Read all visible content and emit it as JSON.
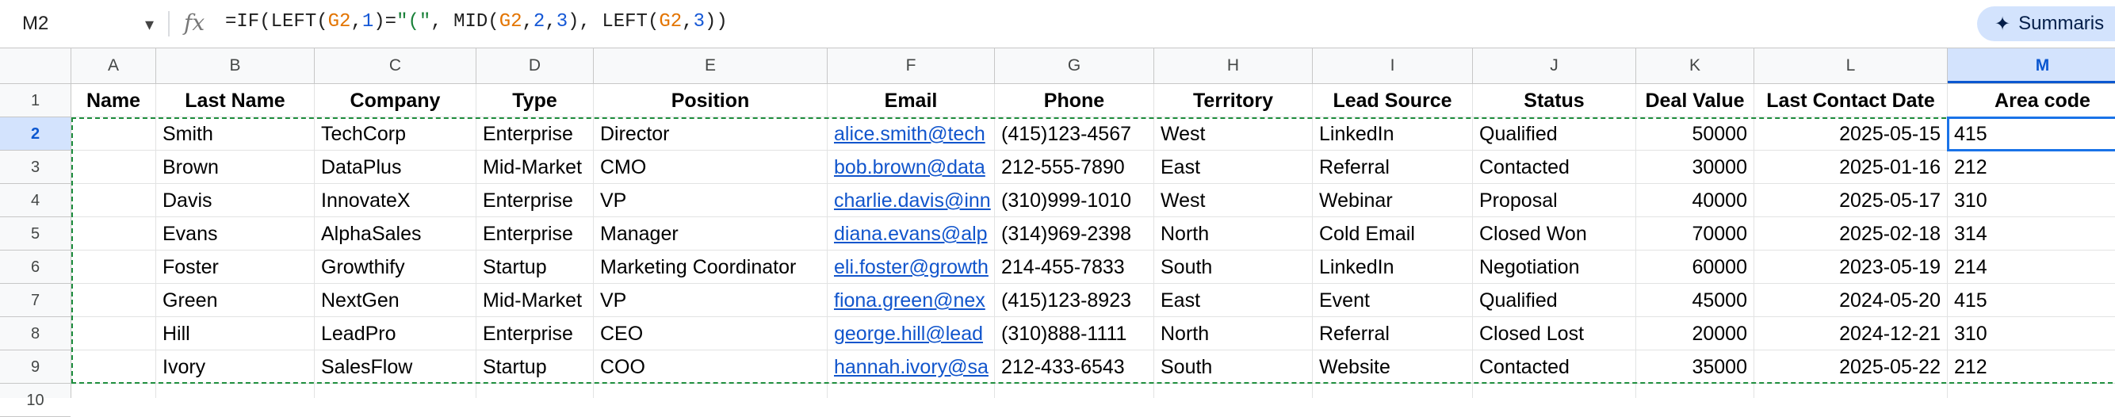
{
  "formula_bar": {
    "name_box": "M2",
    "fx_label": "fx",
    "formula_tokens": [
      {
        "t": "=IF(LEFT(",
        "k": "txt"
      },
      {
        "t": "G2",
        "k": "ref"
      },
      {
        "t": ",",
        "k": "txt"
      },
      {
        "t": "1",
        "k": "num"
      },
      {
        "t": ")=",
        "k": "txt"
      },
      {
        "t": "\"(\"",
        "k": "str"
      },
      {
        "t": ", MID(",
        "k": "txt"
      },
      {
        "t": "G2",
        "k": "ref"
      },
      {
        "t": ",",
        "k": "txt"
      },
      {
        "t": "2",
        "k": "num"
      },
      {
        "t": ",",
        "k": "txt"
      },
      {
        "t": "3",
        "k": "num"
      },
      {
        "t": "), LEFT(",
        "k": "txt"
      },
      {
        "t": "G2",
        "k": "ref"
      },
      {
        "t": ",",
        "k": "txt"
      },
      {
        "t": "3",
        "k": "num"
      },
      {
        "t": "))",
        "k": "txt"
      }
    ],
    "summarize_label": "Summaris"
  },
  "columns": [
    "A",
    "B",
    "C",
    "D",
    "E",
    "F",
    "G",
    "H",
    "I",
    "J",
    "K",
    "L",
    "M"
  ],
  "selected_column": "M",
  "row_numbers": [
    "1",
    "2",
    "3",
    "4",
    "5",
    "6",
    "7",
    "8",
    "9",
    "10"
  ],
  "selected_row": "2",
  "header_row": [
    "Name",
    "Last Name",
    "Company",
    "Type",
    "Position",
    "Email",
    "Phone",
    "Territory",
    "Lead Source",
    "Status",
    "Deal Value",
    "Last Contact Date",
    "Area code"
  ],
  "rows": [
    [
      "",
      "Smith",
      "TechCorp",
      "Enterprise",
      "Director",
      "alice.smith@tech",
      "(415)123-4567",
      "West",
      "LinkedIn",
      "Qualified",
      "50000",
      "2025-05-15",
      "415"
    ],
    [
      "",
      "Brown",
      "DataPlus",
      "Mid-Market",
      "CMO",
      "bob.brown@data",
      "212-555-7890",
      "East",
      "Referral",
      "Contacted",
      "30000",
      "2025-01-16",
      "212"
    ],
    [
      "",
      "Davis",
      "InnovateX",
      "Enterprise",
      "VP",
      "charlie.davis@inn",
      "(310)999-1010",
      "West",
      "Webinar",
      "Proposal",
      "40000",
      "2025-05-17",
      "310"
    ],
    [
      "",
      "Evans",
      "AlphaSales",
      "Enterprise",
      "Manager",
      "diana.evans@alp",
      "(314)969-2398",
      "North",
      "Cold Email",
      "Closed Won",
      "70000",
      "2025-02-18",
      "314"
    ],
    [
      "",
      "Foster",
      "Growthify",
      "Startup",
      "Marketing Coordinator",
      "eli.foster@growth",
      "214-455-7833",
      "South",
      "LinkedIn",
      "Negotiation",
      "60000",
      "2023-05-19",
      "214"
    ],
    [
      "",
      "Green",
      "NextGen",
      "Mid-Market",
      "VP",
      "fiona.green@nex",
      "(415)123-8923",
      "East",
      "Event",
      "Qualified",
      "45000",
      "2024-05-20",
      "415"
    ],
    [
      "",
      "Hill",
      "LeadPro",
      "Enterprise",
      "CEO",
      "george.hill@lead",
      "(310)888-1111",
      "North",
      "Referral",
      "Closed Lost",
      "20000",
      "2024-12-21",
      "310"
    ],
    [
      "",
      "Ivory",
      "SalesFlow",
      "Startup",
      "COO",
      "hannah.ivory@sa",
      "212-433-6543",
      "South",
      "Website",
      "Contacted",
      "35000",
      "2025-05-22",
      "212"
    ]
  ],
  "colors": {
    "selection": "#1a73e8",
    "copy_border": "#1e8e3e",
    "link": "#1155cc"
  }
}
